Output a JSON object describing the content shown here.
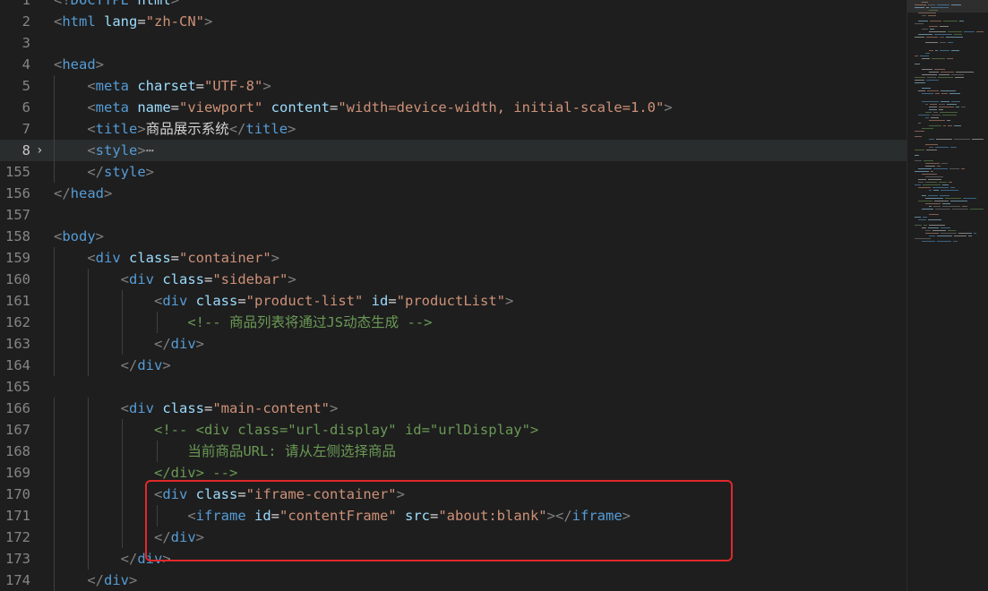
{
  "editor": {
    "lines": [
      {
        "num": "1",
        "tokens": [
          {
            "k": "punc",
            "t": "<!"
          },
          {
            "k": "tag",
            "t": "DOCTYPE"
          },
          {
            "k": "attr",
            "t": " html"
          },
          {
            "k": "punc",
            "t": ">"
          }
        ]
      },
      {
        "num": "2",
        "tokens": [
          {
            "k": "punc",
            "t": "<"
          },
          {
            "k": "tag",
            "t": "html"
          },
          {
            "k": "attr",
            "t": " lang"
          },
          {
            "k": "text",
            "t": "="
          },
          {
            "k": "str",
            "t": "\"zh-CN\""
          },
          {
            "k": "punc",
            "t": ">"
          }
        ]
      },
      {
        "num": "3",
        "tokens": []
      },
      {
        "num": "4",
        "tokens": [
          {
            "k": "punc",
            "t": "<"
          },
          {
            "k": "tag",
            "t": "head"
          },
          {
            "k": "punc",
            "t": ">"
          }
        ]
      },
      {
        "num": "5",
        "tokens": [
          {
            "k": "text",
            "t": "    "
          },
          {
            "k": "punc",
            "t": "<"
          },
          {
            "k": "tag",
            "t": "meta"
          },
          {
            "k": "attr",
            "t": " charset"
          },
          {
            "k": "text",
            "t": "="
          },
          {
            "k": "str",
            "t": "\"UTF-8\""
          },
          {
            "k": "punc",
            "t": ">"
          }
        ]
      },
      {
        "num": "6",
        "tokens": [
          {
            "k": "text",
            "t": "    "
          },
          {
            "k": "punc",
            "t": "<"
          },
          {
            "k": "tag",
            "t": "meta"
          },
          {
            "k": "attr",
            "t": " name"
          },
          {
            "k": "text",
            "t": "="
          },
          {
            "k": "str",
            "t": "\"viewport\""
          },
          {
            "k": "attr",
            "t": " content"
          },
          {
            "k": "text",
            "t": "="
          },
          {
            "k": "str",
            "t": "\"width=device-width, initial-scale=1.0\""
          },
          {
            "k": "punc",
            "t": ">"
          }
        ]
      },
      {
        "num": "7",
        "tokens": [
          {
            "k": "text",
            "t": "    "
          },
          {
            "k": "punc",
            "t": "<"
          },
          {
            "k": "tag",
            "t": "title"
          },
          {
            "k": "punc",
            "t": ">"
          },
          {
            "k": "text",
            "t": "商品展示系统"
          },
          {
            "k": "punc",
            "t": "</"
          },
          {
            "k": "tag",
            "t": "title"
          },
          {
            "k": "punc",
            "t": ">"
          }
        ]
      },
      {
        "num": "8",
        "current": true,
        "fold": "›",
        "tokens": [
          {
            "k": "text",
            "t": "    "
          },
          {
            "k": "punc",
            "t": "<"
          },
          {
            "k": "tag",
            "t": "style"
          },
          {
            "k": "punc",
            "t": ">"
          },
          {
            "k": "fold",
            "t": "⋯"
          }
        ]
      },
      {
        "num": "155",
        "tokens": [
          {
            "k": "text",
            "t": "    "
          },
          {
            "k": "punc",
            "t": "</"
          },
          {
            "k": "tag",
            "t": "style"
          },
          {
            "k": "punc",
            "t": ">"
          }
        ]
      },
      {
        "num": "156",
        "tokens": [
          {
            "k": "punc",
            "t": "</"
          },
          {
            "k": "tag",
            "t": "head"
          },
          {
            "k": "punc",
            "t": ">"
          }
        ]
      },
      {
        "num": "157",
        "tokens": []
      },
      {
        "num": "158",
        "tokens": [
          {
            "k": "punc",
            "t": "<"
          },
          {
            "k": "tag",
            "t": "body"
          },
          {
            "k": "punc",
            "t": ">"
          }
        ]
      },
      {
        "num": "159",
        "tokens": [
          {
            "k": "text",
            "t": "    "
          },
          {
            "k": "punc",
            "t": "<"
          },
          {
            "k": "tag",
            "t": "div"
          },
          {
            "k": "attr",
            "t": " class"
          },
          {
            "k": "text",
            "t": "="
          },
          {
            "k": "str",
            "t": "\"container\""
          },
          {
            "k": "punc",
            "t": ">"
          }
        ]
      },
      {
        "num": "160",
        "tokens": [
          {
            "k": "text",
            "t": "        "
          },
          {
            "k": "punc",
            "t": "<"
          },
          {
            "k": "tag",
            "t": "div"
          },
          {
            "k": "attr",
            "t": " class"
          },
          {
            "k": "text",
            "t": "="
          },
          {
            "k": "str",
            "t": "\"sidebar\""
          },
          {
            "k": "punc",
            "t": ">"
          }
        ]
      },
      {
        "num": "161",
        "tokens": [
          {
            "k": "text",
            "t": "            "
          },
          {
            "k": "punc",
            "t": "<"
          },
          {
            "k": "tag",
            "t": "div"
          },
          {
            "k": "attr",
            "t": " class"
          },
          {
            "k": "text",
            "t": "="
          },
          {
            "k": "str",
            "t": "\"product-list\""
          },
          {
            "k": "attr",
            "t": " id"
          },
          {
            "k": "text",
            "t": "="
          },
          {
            "k": "str",
            "t": "\"productList\""
          },
          {
            "k": "punc",
            "t": ">"
          }
        ]
      },
      {
        "num": "162",
        "tokens": [
          {
            "k": "text",
            "t": "                "
          },
          {
            "k": "com",
            "t": "<!-- 商品列表将通过JS动态生成 -->"
          }
        ]
      },
      {
        "num": "163",
        "tokens": [
          {
            "k": "text",
            "t": "            "
          },
          {
            "k": "punc",
            "t": "</"
          },
          {
            "k": "tag",
            "t": "div"
          },
          {
            "k": "punc",
            "t": ">"
          }
        ]
      },
      {
        "num": "164",
        "tokens": [
          {
            "k": "text",
            "t": "        "
          },
          {
            "k": "punc",
            "t": "</"
          },
          {
            "k": "tag",
            "t": "div"
          },
          {
            "k": "punc",
            "t": ">"
          }
        ]
      },
      {
        "num": "165",
        "tokens": []
      },
      {
        "num": "166",
        "tokens": [
          {
            "k": "text",
            "t": "        "
          },
          {
            "k": "punc",
            "t": "<"
          },
          {
            "k": "tag",
            "t": "div"
          },
          {
            "k": "attr",
            "t": " class"
          },
          {
            "k": "text",
            "t": "="
          },
          {
            "k": "str",
            "t": "\"main-content\""
          },
          {
            "k": "punc",
            "t": ">"
          }
        ]
      },
      {
        "num": "167",
        "tokens": [
          {
            "k": "text",
            "t": "            "
          },
          {
            "k": "com",
            "t": "<!-- <div class=\"url-display\" id=\"urlDisplay\">"
          }
        ]
      },
      {
        "num": "168",
        "tokens": [
          {
            "k": "text",
            "t": "                "
          },
          {
            "k": "com",
            "t": "当前商品URL: 请从左侧选择商品"
          }
        ]
      },
      {
        "num": "169",
        "tokens": [
          {
            "k": "text",
            "t": "            "
          },
          {
            "k": "com",
            "t": "</div> -->"
          }
        ]
      },
      {
        "num": "170",
        "tokens": [
          {
            "k": "text",
            "t": "            "
          },
          {
            "k": "punc",
            "t": "<"
          },
          {
            "k": "tag",
            "t": "div"
          },
          {
            "k": "attr",
            "t": " class"
          },
          {
            "k": "text",
            "t": "="
          },
          {
            "k": "str",
            "t": "\"iframe-container\""
          },
          {
            "k": "punc",
            "t": ">"
          }
        ]
      },
      {
        "num": "171",
        "tokens": [
          {
            "k": "text",
            "t": "                "
          },
          {
            "k": "punc",
            "t": "<"
          },
          {
            "k": "tag",
            "t": "iframe"
          },
          {
            "k": "attr",
            "t": " id"
          },
          {
            "k": "text",
            "t": "="
          },
          {
            "k": "str",
            "t": "\"contentFrame\""
          },
          {
            "k": "attr",
            "t": " src"
          },
          {
            "k": "text",
            "t": "="
          },
          {
            "k": "str",
            "t": "\"about:blank\""
          },
          {
            "k": "punc",
            "t": "></"
          },
          {
            "k": "tag",
            "t": "iframe"
          },
          {
            "k": "punc",
            "t": ">"
          }
        ]
      },
      {
        "num": "172",
        "tokens": [
          {
            "k": "text",
            "t": "            "
          },
          {
            "k": "punc",
            "t": "</"
          },
          {
            "k": "tag",
            "t": "div"
          },
          {
            "k": "punc",
            "t": ">"
          }
        ]
      },
      {
        "num": "173",
        "tokens": [
          {
            "k": "text",
            "t": "        "
          },
          {
            "k": "punc",
            "t": "</"
          },
          {
            "k": "tag",
            "t": "div"
          },
          {
            "k": "punc",
            "t": ">"
          }
        ]
      },
      {
        "num": "174",
        "tokens": [
          {
            "k": "text",
            "t": "    "
          },
          {
            "k": "punc",
            "t": "</"
          },
          {
            "k": "tag",
            "t": "div"
          },
          {
            "k": "punc",
            "t": ">"
          }
        ]
      }
    ]
  },
  "colors": {
    "background": "#1e1e1e",
    "highlight_box": "#e0292b"
  }
}
